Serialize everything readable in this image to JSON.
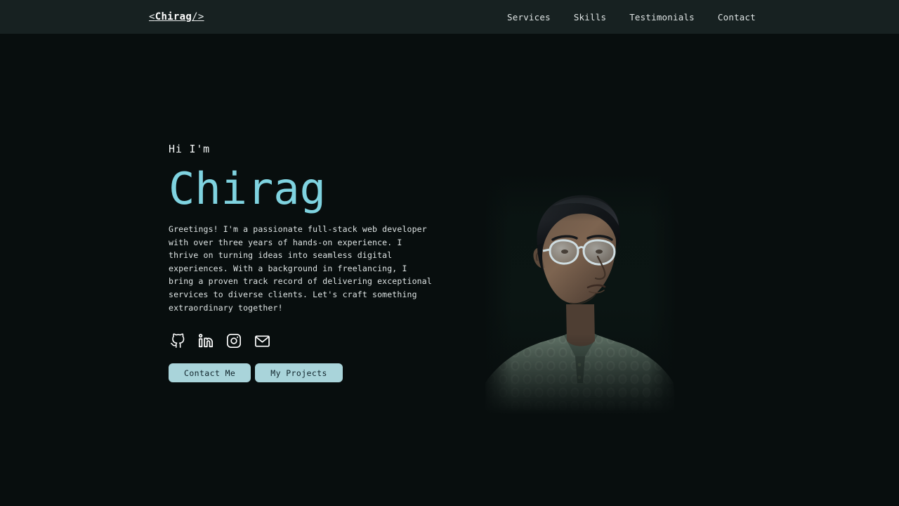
{
  "colors": {
    "page_background": "#080e0e",
    "header_background": "#172121",
    "accent_cyan": "#7fd3e0",
    "button_background": "#a9d4da",
    "button_text": "#10242b",
    "body_text": "#dfe5e5"
  },
  "header": {
    "brand": {
      "open_angle": "<",
      "name": "Chirag",
      "close_angle": "/>"
    },
    "nav": [
      {
        "label": "Services"
      },
      {
        "label": "Skills"
      },
      {
        "label": "Testimonials"
      },
      {
        "label": "Contact"
      }
    ]
  },
  "hero": {
    "greeting": "Hi I'm",
    "name": "Chirag",
    "bio": "Greetings! I'm a passionate full-stack web developer with over three years of hands-on experience. I thrive on turning ideas into seamless digital experiences. With a background in freelancing, I bring a proven track record of delivering exceptional services to diverse clients. Let's craft something extraordinary together!",
    "socials": [
      {
        "icon": "github-icon",
        "name": "GitHub"
      },
      {
        "icon": "linkedin-icon",
        "name": "LinkedIn"
      },
      {
        "icon": "instagram-icon",
        "name": "Instagram"
      },
      {
        "icon": "mail-icon",
        "name": "Email"
      }
    ],
    "buttons": {
      "primary_label": "Contact Me",
      "secondary_label": "My Projects"
    },
    "portrait_alt": "Portrait of Chirag wearing glasses and a sage green kurta"
  }
}
